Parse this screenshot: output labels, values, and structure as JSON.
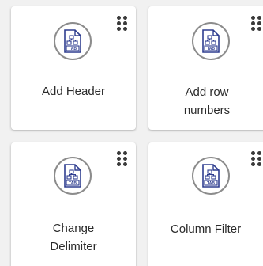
{
  "colors": {
    "background": "#f1f1f1",
    "card": "#ffffff",
    "icon_stroke": "#2e3d8f",
    "circle_border": "#8c8c8c",
    "text": "#2b2b2b"
  },
  "cards": [
    {
      "label": "Add Header",
      "icon": "tab-file-icon",
      "icon_text": "TAB"
    },
    {
      "label": "Add row\nnumbers",
      "icon": "tab-file-icon",
      "icon_text": "TAB"
    },
    {
      "label": "Change\nDelimiter",
      "icon": "tab-file-icon",
      "icon_text": "TAB"
    },
    {
      "label": "Column Filter",
      "icon": "tab-file-icon",
      "icon_text": "TAB"
    }
  ]
}
